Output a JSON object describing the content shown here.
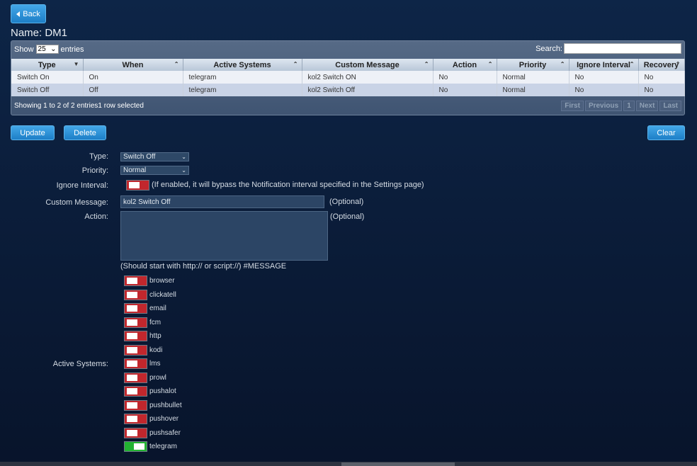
{
  "back_label": "Back",
  "page_title": "Name: DM1",
  "table": {
    "show_label": "Show",
    "entries_value": "25",
    "entries_label": "entries",
    "search_label": "Search:",
    "columns": [
      "Type",
      "When",
      "Active Systems",
      "Custom Message",
      "Action",
      "Priority",
      "Ignore Interval",
      "Recovery"
    ],
    "rows": [
      [
        "Switch On",
        "On",
        "telegram",
        "kol2 Switch ON",
        "No",
        "Normal",
        "No",
        "No"
      ],
      [
        "Switch Off",
        "Off",
        "telegram",
        "kol2 Switch Off",
        "No",
        "Normal",
        "No",
        "No"
      ]
    ],
    "info": "Showing 1 to 2 of 2 entries1 row selected",
    "pager": [
      "First",
      "Previous",
      "1",
      "Next",
      "Last"
    ]
  },
  "buttons": {
    "update": "Update",
    "delete": "Delete",
    "clear": "Clear"
  },
  "form": {
    "type_label": "Type:",
    "type_value": "Switch Off",
    "priority_label": "Priority:",
    "priority_value": "Normal",
    "ignore_label": "Ignore Interval:",
    "ignore_note": "(If enabled, it will bypass the Notification interval specified in the Settings page)",
    "message_label": "Custom Message:",
    "message_value": "kol2 Switch Off",
    "message_note": "(Optional)",
    "action_label": "Action:",
    "action_note": "(Optional)",
    "action_hint": "(Should start with http:// or script://) #MESSAGE",
    "active_label": "Active Systems:"
  },
  "systems": [
    {
      "name": "browser",
      "on": false
    },
    {
      "name": "clickatell",
      "on": false
    },
    {
      "name": "email",
      "on": false
    },
    {
      "name": "fcm",
      "on": false
    },
    {
      "name": "http",
      "on": false
    },
    {
      "name": "kodi",
      "on": false
    },
    {
      "name": "lms",
      "on": false
    },
    {
      "name": "prowl",
      "on": false
    },
    {
      "name": "pushalot",
      "on": false
    },
    {
      "name": "pushbullet",
      "on": false
    },
    {
      "name": "pushover",
      "on": false
    },
    {
      "name": "pushsafer",
      "on": false
    },
    {
      "name": "telegram",
      "on": true
    }
  ],
  "colors": {
    "accent": "#2a8fd8",
    "toggle_off": "#c1272d",
    "toggle_on": "#22b331"
  }
}
